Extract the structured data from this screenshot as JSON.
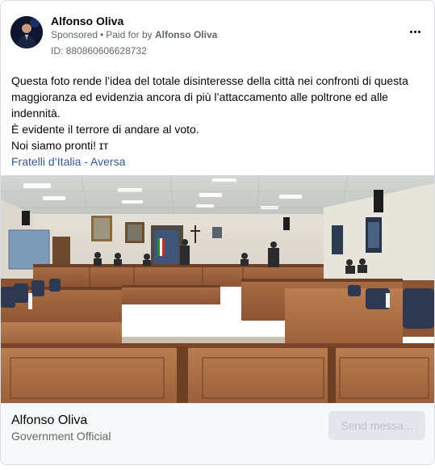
{
  "post": {
    "author": "Alfonso Oliva",
    "sponsored_label": "Sponsored",
    "separator": "•",
    "paid_for_prefix": "Paid for by",
    "paid_for_name": "Alfonso Oliva",
    "ad_id": "ID: 880860606628732",
    "more_icon": "more-horizontal-icon",
    "text_lines": [
      "Questa foto rende l’idea del totale disinteresse della città nei confronti di questa maggioranza ed evidenzia ancora di più l’attaccamento alle poltrone ed alle indennità.",
      "È evidente il terrore di andare al voto.",
      "Noi siamo pronti! ɪᴛ"
    ],
    "page_link": "Fratelli d’Italia - Aversa",
    "image_subject": "council-chamber-photo"
  },
  "footer": {
    "title": "Alfonso Oliva",
    "subtitle": "Government Official",
    "button_label": "Send messa..."
  },
  "colors": {
    "link": "#385898",
    "secondary_text": "#65676b",
    "button_bg": "#e4e6eb",
    "button_text": "#bcc0c4"
  }
}
